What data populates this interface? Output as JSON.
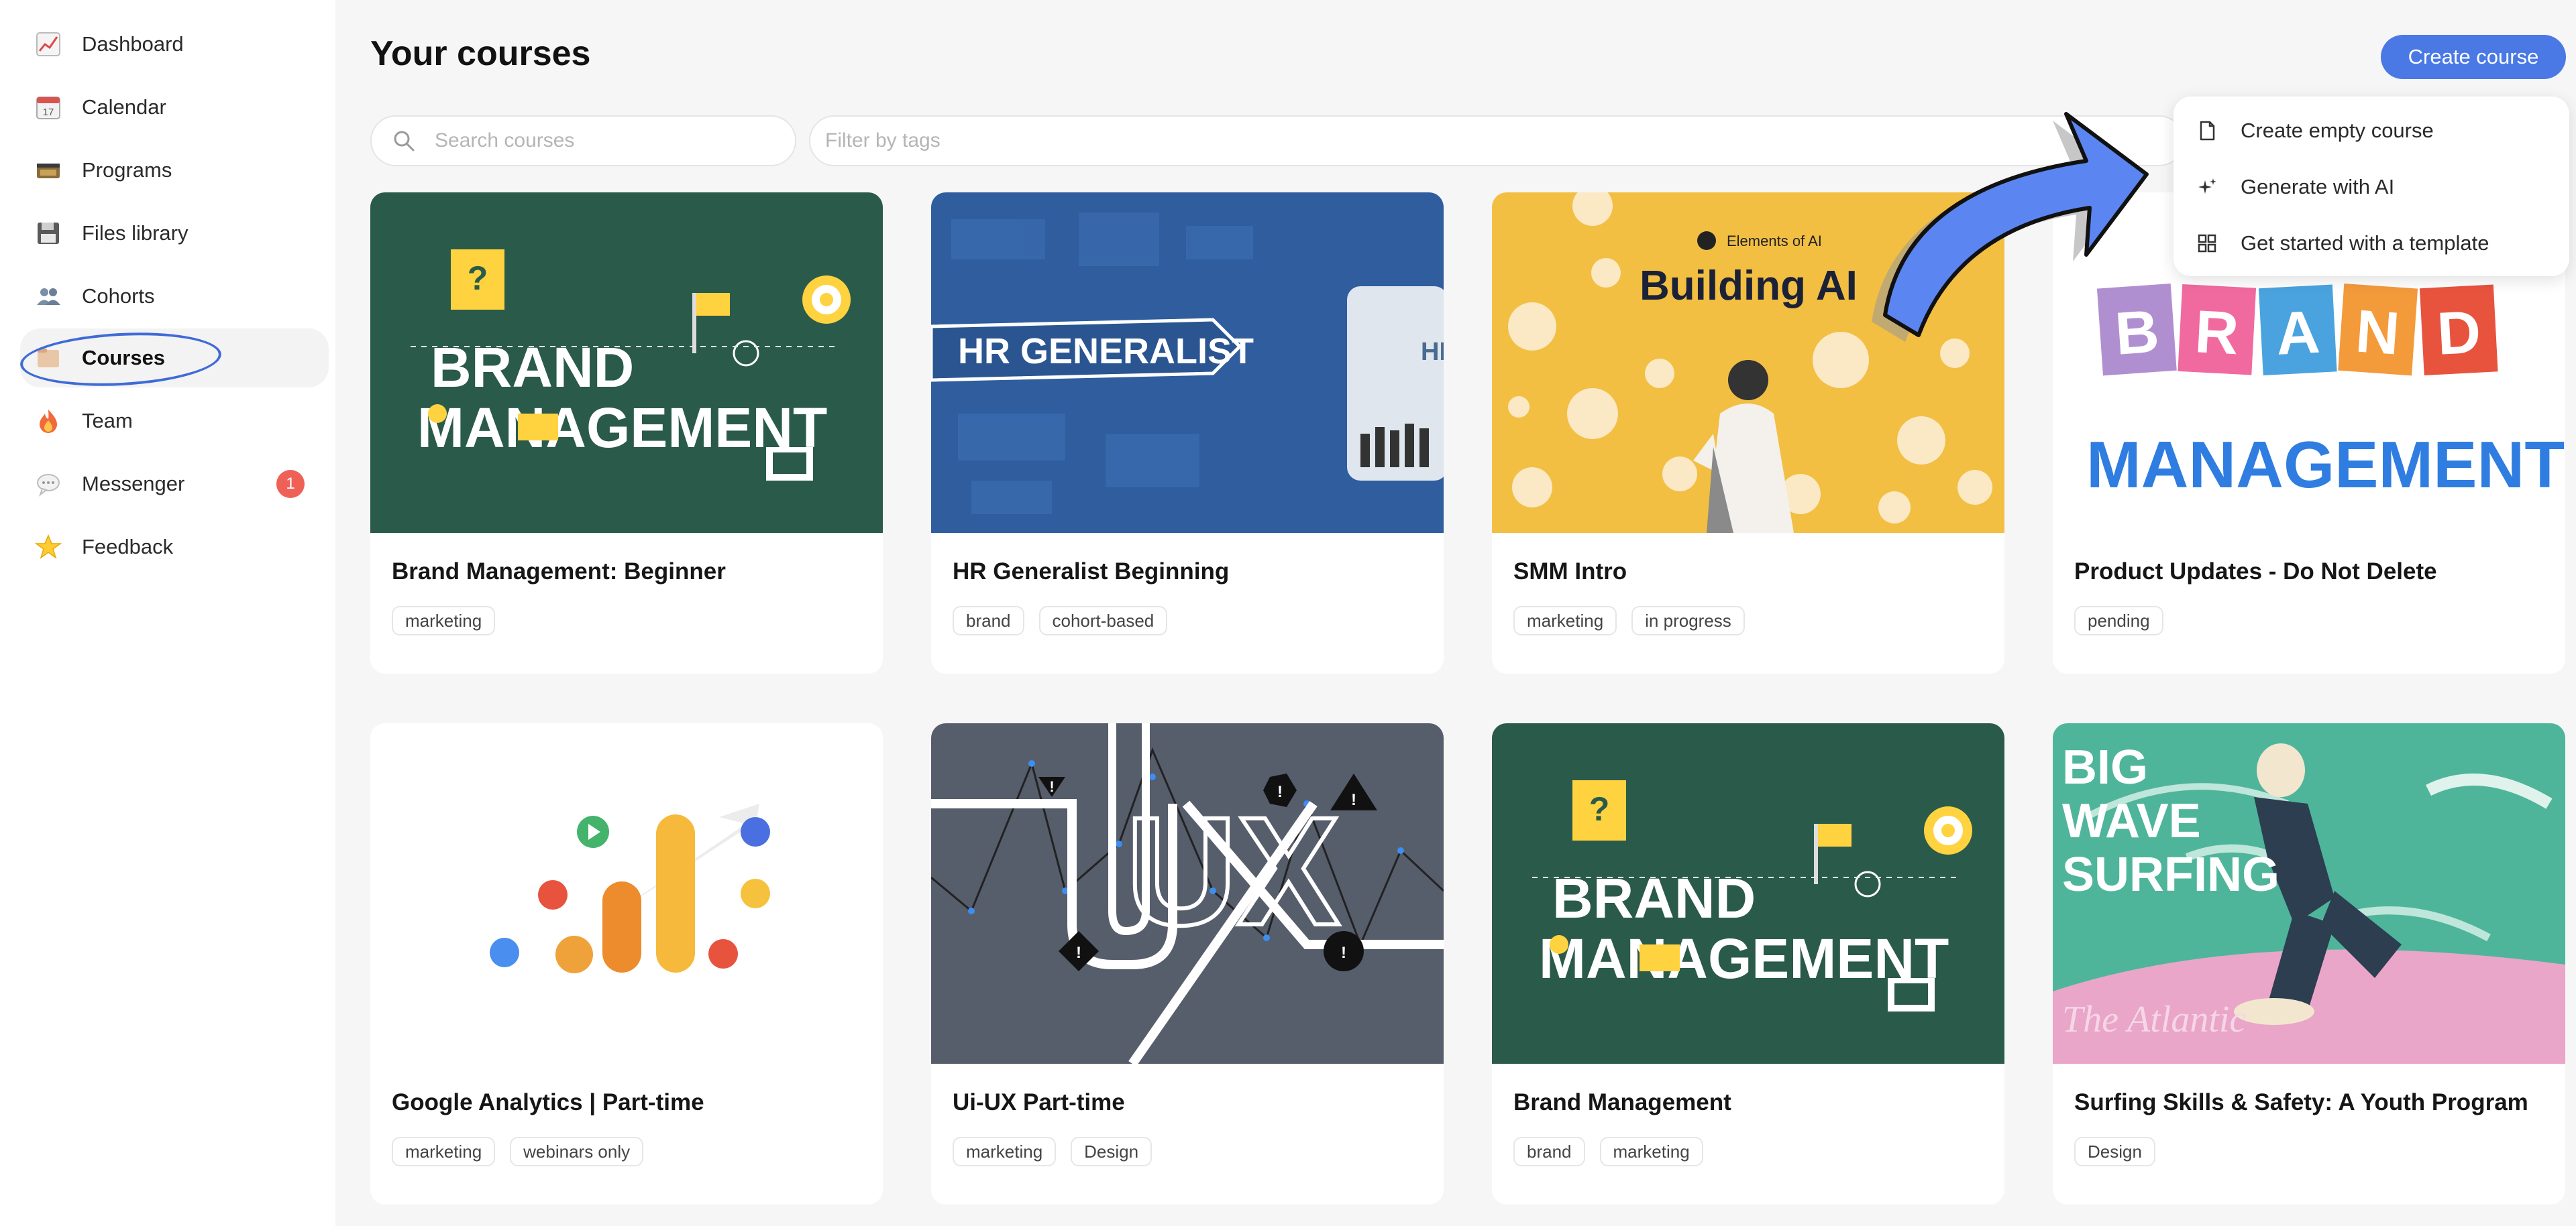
{
  "sidebar": {
    "items": [
      {
        "label": "Dashboard",
        "icon": "chart-icon"
      },
      {
        "label": "Calendar",
        "icon": "calendar-icon"
      },
      {
        "label": "Programs",
        "icon": "film-icon"
      },
      {
        "label": "Files library",
        "icon": "floppy-icon"
      },
      {
        "label": "Cohorts",
        "icon": "people-icon"
      },
      {
        "label": "Courses",
        "icon": "folder-icon",
        "active": true
      },
      {
        "label": "Team",
        "icon": "fire-icon"
      },
      {
        "label": "Messenger",
        "icon": "speech-bubble-icon",
        "badge": "1"
      },
      {
        "label": "Feedback",
        "icon": "star-icon"
      }
    ]
  },
  "header": {
    "title": "Your courses",
    "create_label": "Create course"
  },
  "search": {
    "placeholder": "Search courses"
  },
  "filter": {
    "placeholder": "Filter by tags"
  },
  "dropdown": {
    "items": [
      {
        "label": "Create empty course",
        "icon": "document-icon"
      },
      {
        "label": "Generate with AI",
        "icon": "sparkle-icon"
      },
      {
        "label": "Get started with a template",
        "icon": "grid-icon"
      }
    ]
  },
  "courses": [
    {
      "title": "Brand Management: Beginner",
      "tags": [
        "marketing"
      ],
      "thumb_text": [
        "BRAND",
        "MANAGEMENT"
      ]
    },
    {
      "title": "HR Generalist Beginning",
      "tags": [
        "brand",
        "cohort-based"
      ],
      "thumb_text": [
        "HR GENERALIST",
        "HR"
      ]
    },
    {
      "title": "SMM Intro",
      "tags": [
        "marketing",
        "in progress"
      ],
      "thumb_text": [
        "Elements of AI",
        "Building AI"
      ]
    },
    {
      "title": "Product Updates - Do Not Delete",
      "tags": [
        "pending"
      ],
      "thumb_text": [
        "B",
        "R",
        "A",
        "N",
        "D",
        "MANAGEMENT"
      ]
    },
    {
      "title": "Google Analytics | Part-time",
      "tags": [
        "marketing",
        "webinars only"
      ],
      "thumb_text": []
    },
    {
      "title": "Ui-UX Part-time",
      "tags": [
        "marketing",
        "Design"
      ],
      "thumb_text": [
        "UX"
      ]
    },
    {
      "title": "Brand Management",
      "tags": [
        "brand",
        "marketing"
      ],
      "thumb_text": [
        "BRAND",
        "MANAGEMENT"
      ]
    },
    {
      "title": "Surfing Skills & Safety: A Youth Program",
      "tags": [
        "Design"
      ],
      "thumb_text": [
        "BIG",
        "WAVE",
        "SURFING",
        "The Atlantic"
      ]
    }
  ],
  "colors": {
    "accent": "#4a79e5",
    "badge": "#ef6157",
    "brand_green": "#2a5a4a"
  }
}
